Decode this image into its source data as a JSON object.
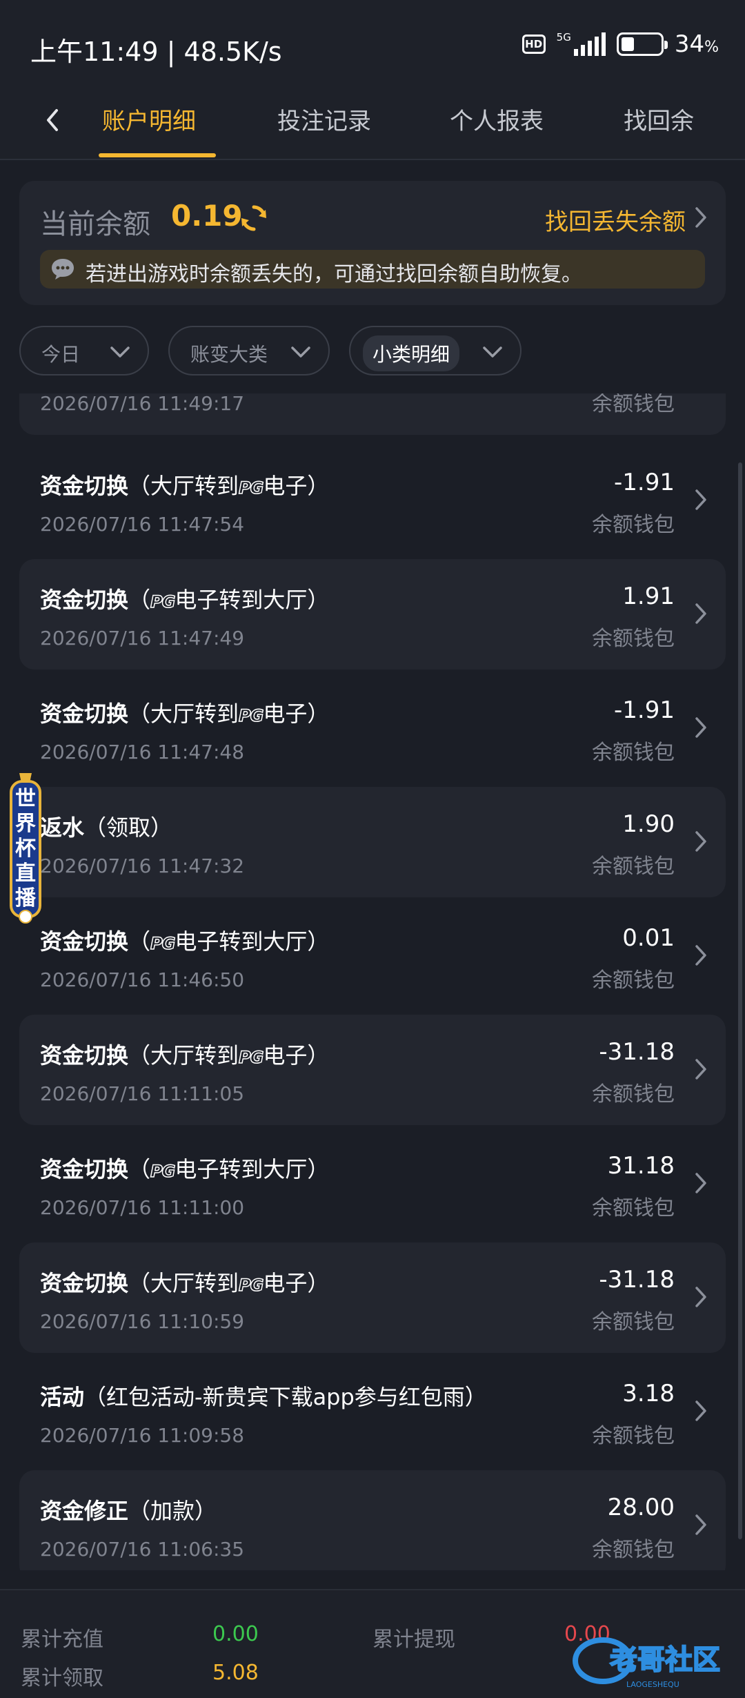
{
  "status_bar": {
    "time_speed": "上午11:49 | 48.5K/s",
    "hd": "HD",
    "network": "5G",
    "battery_level": 0.34,
    "battery_percent": "34",
    "percent_sign": "%"
  },
  "tabs": [
    "账户明细",
    "投注记录",
    "个人报表",
    "找回余"
  ],
  "active_tab": 0,
  "balance": {
    "label": "当前余额",
    "value": "0.19",
    "recover_link": "找回丢失余额",
    "notice": "若进出游戏时余额丢失的，可通过找回余额自助恢复。"
  },
  "filters": [
    {
      "label": "今日",
      "selected": false
    },
    {
      "label": "账变大类",
      "selected": false
    },
    {
      "label": "小类明细",
      "selected": true
    }
  ],
  "partial_record": {
    "time": "2026/07/16 11:49:17",
    "wallet": "余额钱包"
  },
  "records": [
    {
      "title_bold": "资金切换",
      "pre": "（大厅转到",
      "badge": "PG",
      "post": "电子）",
      "time": "2026/07/16 11:47:54",
      "amount": "-1.91",
      "wallet": "余额钱包"
    },
    {
      "title_bold": "资金切换",
      "pre": "（",
      "badge": "PG",
      "post": "电子转到大厅）",
      "time": "2026/07/16 11:47:49",
      "amount": "1.91",
      "wallet": "余额钱包"
    },
    {
      "title_bold": "资金切换",
      "pre": "（大厅转到",
      "badge": "PG",
      "post": "电子）",
      "time": "2026/07/16 11:47:48",
      "amount": "-1.91",
      "wallet": "余额钱包"
    },
    {
      "title_bold": "返水",
      "pre": "（领取）",
      "badge": "",
      "post": "",
      "time": "2026/07/16 11:47:32",
      "amount": "1.90",
      "wallet": "余额钱包"
    },
    {
      "title_bold": "资金切换",
      "pre": "（",
      "badge": "PG",
      "post": "电子转到大厅）",
      "time": "2026/07/16 11:46:50",
      "amount": "0.01",
      "wallet": "余额钱包"
    },
    {
      "title_bold": "资金切换",
      "pre": "（大厅转到",
      "badge": "PG",
      "post": "电子）",
      "time": "2026/07/16 11:11:05",
      "amount": "-31.18",
      "wallet": "余额钱包"
    },
    {
      "title_bold": "资金切换",
      "pre": "（",
      "badge": "PG",
      "post": "电子转到大厅）",
      "time": "2026/07/16 11:11:00",
      "amount": "31.18",
      "wallet": "余额钱包"
    },
    {
      "title_bold": "资金切换",
      "pre": "（大厅转到",
      "badge": "PG",
      "post": "电子）",
      "time": "2026/07/16 11:10:59",
      "amount": "-31.18",
      "wallet": "余额钱包"
    },
    {
      "title_bold": "活动",
      "pre": "（红包活动-新贵宾下载app参与红包雨）",
      "badge": "",
      "post": "",
      "time": "2026/07/16 11:09:58",
      "amount": "3.18",
      "wallet": "余额钱包"
    },
    {
      "title_bold": "资金修正",
      "pre": "（加款）",
      "badge": "",
      "post": "",
      "time": "2026/07/16 11:06:35",
      "amount": "28.00",
      "wallet": "余额钱包"
    }
  ],
  "float_badge": {
    "text": "世界杯直播"
  },
  "footer": {
    "recharge_label": "累计充值",
    "recharge_value": "0.00",
    "withdraw_label": "累计提现",
    "withdraw_value": "0.00",
    "claim_label": "累计领取",
    "claim_value": "5.08",
    "watermark": "老哥社区",
    "watermark_sub": "LAOGESHEQU"
  },
  "colors": {
    "accent": "#f5b731",
    "positive": "#3cc94f",
    "negative": "#e5484d",
    "background": "#1b1e26"
  }
}
